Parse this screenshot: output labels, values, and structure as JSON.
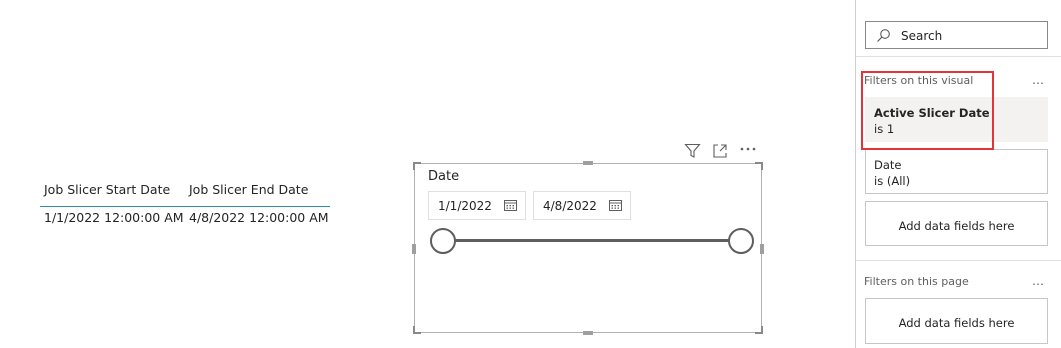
{
  "table": {
    "headers": [
      "Job Slicer Start Date",
      "Job Slicer End Date"
    ],
    "row": [
      "1/1/2022 12:00:00 AM",
      "4/8/2022 12:00:00 AM"
    ]
  },
  "slicer": {
    "title": "Date",
    "start": "1/1/2022",
    "end": "4/8/2022",
    "header_icons": [
      "filter-icon",
      "focus-mode-icon",
      "more-options-icon"
    ]
  },
  "filters_pane": {
    "search_placeholder": "Search",
    "visual_section": "Filters on this visual",
    "page_section": "Filters on this page",
    "more": "…",
    "visual_filters": [
      {
        "name": "Active Slicer Date",
        "condition": "is 1"
      },
      {
        "name": "Date",
        "condition": "is (All)"
      }
    ],
    "add_fields": "Add data fields here"
  },
  "colors": {
    "highlight": "#e3343a",
    "table_header_line": "#2b8fb3",
    "slider": "#605e5c"
  }
}
